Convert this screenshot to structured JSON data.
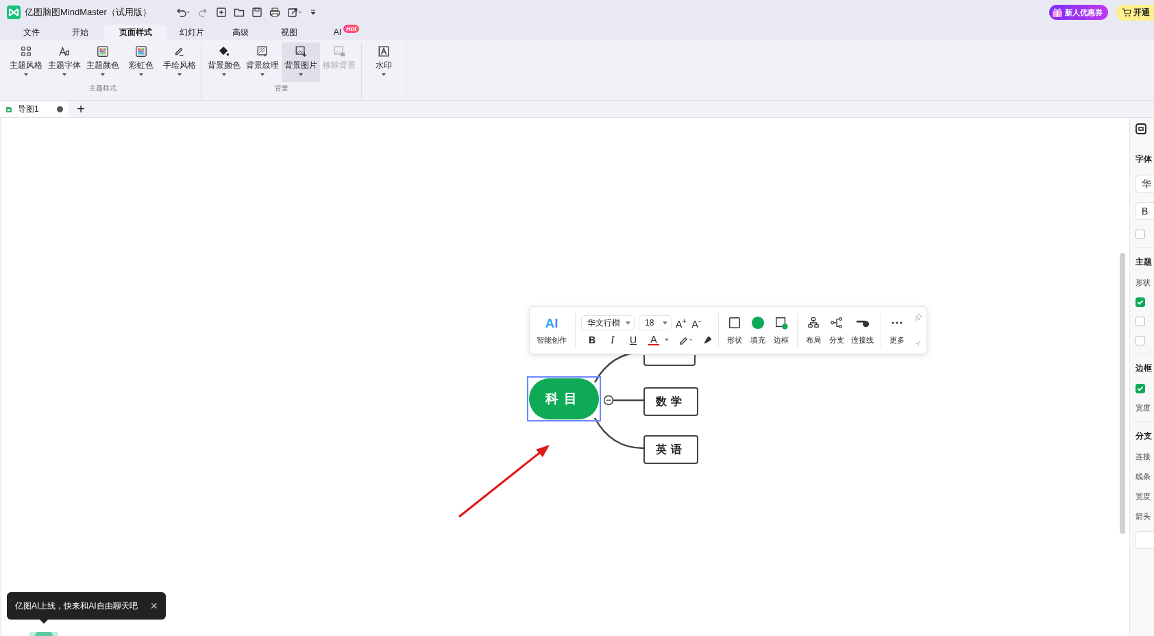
{
  "window": {
    "title": "亿图脑图MindMaster（试用版）"
  },
  "title_buttons": [
    {
      "label": "新人优惠券",
      "kind": "promo"
    },
    {
      "label": "开通",
      "kind": "upgrade"
    }
  ],
  "tabs": [
    {
      "label": "文件",
      "selected": false
    },
    {
      "label": "开始",
      "selected": false
    },
    {
      "label": "页面样式",
      "selected": true
    },
    {
      "label": "幻灯片",
      "selected": false
    },
    {
      "label": "高级",
      "selected": false
    },
    {
      "label": "视图",
      "selected": false
    },
    {
      "label": "AI",
      "selected": false,
      "badge": "Hot"
    }
  ],
  "ribbon_groups": [
    {
      "label": "主题样式",
      "items": [
        {
          "label": "主题风格",
          "disabled": false,
          "highlighted": false,
          "dropdown": true
        },
        {
          "label": "主题字体",
          "disabled": false,
          "highlighted": false,
          "dropdown": true
        },
        {
          "label": "主题颜色",
          "disabled": false,
          "highlighted": false,
          "dropdown": true
        },
        {
          "label": "彩虹色",
          "disabled": false,
          "highlighted": false,
          "dropdown": true
        },
        {
          "label": "手绘风格",
          "disabled": false,
          "highlighted": false,
          "dropdown": true
        }
      ]
    },
    {
      "label": "背景",
      "items": [
        {
          "label": "背景颜色",
          "disabled": false,
          "highlighted": false,
          "dropdown": true
        },
        {
          "label": "背景纹理",
          "disabled": false,
          "highlighted": false,
          "dropdown": true
        },
        {
          "label": "背景图片",
          "disabled": false,
          "highlighted": true,
          "dropdown": true
        },
        {
          "label": "移除背景",
          "disabled": true,
          "highlighted": false,
          "dropdown": false
        }
      ]
    },
    {
      "items": [
        {
          "label": "水印",
          "disabled": false,
          "highlighted": false,
          "dropdown": true
        }
      ]
    }
  ],
  "doc_tabs": [
    {
      "label": "导图1",
      "selected": true,
      "modified": true
    }
  ],
  "add_tab": "+",
  "mindmap": {
    "central": {
      "label": "科目",
      "selected": true
    },
    "topics": [
      {
        "label": "数学"
      },
      {
        "label": "英语"
      }
    ]
  },
  "float_toolbar": {
    "ai": {
      "icon_text": "AI",
      "label": "智能创作"
    },
    "font": "华文行楷",
    "size": "18",
    "grow": "A$^{+}$",
    "shrink": "A$^{-}$",
    "format": [
      {
        "label": "B",
        "kind": "bold"
      },
      {
        "label": "I",
        "kind": "italic"
      },
      {
        "label": "U",
        "kind": "underline"
      },
      {
        "label": "A",
        "kind": "color"
      }
    ],
    "tools": [
      {
        "label": "形状",
        "kind": "shape"
      },
      {
        "label": "填充",
        "kind": "fill"
      },
      {
        "label": "边框",
        "kind": "border"
      },
      {
        "label": "布局",
        "kind": "layout"
      },
      {
        "label": "分支",
        "kind": "branch"
      },
      {
        "label": "连接线",
        "kind": "connector"
      },
      {
        "label": "更多",
        "kind": "more"
      }
    ]
  },
  "toast": {
    "text": "亿图AI上线，快来和AI自由聊天吧",
    "close": "×"
  },
  "right_panel": {
    "sections": [
      {
        "title": "字体",
        "rows": [
          {
            "kind": "field",
            "text": "华"
          },
          {
            "kind": "field",
            "text": "B"
          },
          {
            "kind": "check",
            "checked": false
          }
        ]
      },
      {
        "title": "主题",
        "rows": [
          {
            "kind": "label",
            "text": "形状"
          },
          {
            "kind": "check",
            "checked": true
          },
          {
            "kind": "check",
            "checked": false
          },
          {
            "kind": "check",
            "checked": false
          }
        ]
      },
      {
        "title": "边框",
        "rows": [
          {
            "kind": "check",
            "checked": true
          },
          {
            "kind": "label",
            "text": "宽度"
          }
        ]
      },
      {
        "title": "分支",
        "rows": [
          {
            "kind": "label",
            "text": "连接"
          },
          {
            "kind": "label",
            "text": "线条"
          },
          {
            "kind": "label",
            "text": "宽度"
          },
          {
            "kind": "label",
            "text": "箭头"
          },
          {
            "kind": "field",
            "text": ""
          }
        ]
      }
    ]
  }
}
